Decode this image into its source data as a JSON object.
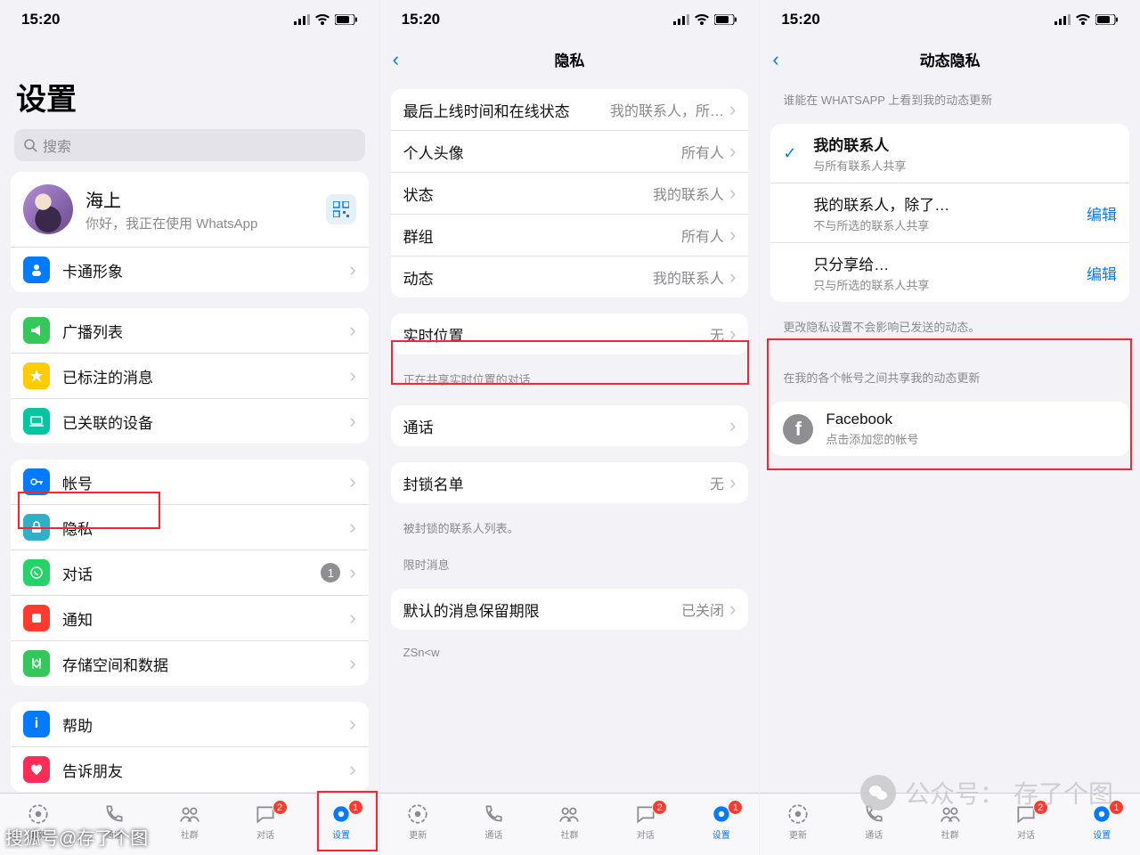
{
  "statusbar": {
    "time": "15:20"
  },
  "tabs": {
    "updates": "更新",
    "calls": "通话",
    "communities": "社群",
    "chats": "对话",
    "settings": "设置",
    "chats_badge": "2",
    "settings_badge": "1"
  },
  "screen1": {
    "title": "设置",
    "search_placeholder": "搜索",
    "profile": {
      "name": "海上",
      "status": "你好，我正在使用 WhatsApp"
    },
    "avatar_row": "卡通形象",
    "group_lists": {
      "broadcast": "广播列表",
      "starred": "已标注的消息",
      "linked": "已关联的设备"
    },
    "group_main": {
      "account": "帐号",
      "privacy": "隐私",
      "chats": "对话",
      "chats_badge": "1",
      "notifications": "通知",
      "storage": "存储空间和数据"
    },
    "group_help": {
      "help": "帮助",
      "tell": "告诉朋友"
    }
  },
  "screen2": {
    "nav_title": "隐私",
    "rows": {
      "lastseen": {
        "label": "最后上线时间和在线状态",
        "value": "我的联系人，所…"
      },
      "photo": {
        "label": "个人头像",
        "value": "所有人"
      },
      "about": {
        "label": "状态",
        "value": "我的联系人"
      },
      "groups": {
        "label": "群组",
        "value": "所有人"
      },
      "status": {
        "label": "动态",
        "value": "我的联系人"
      },
      "live": {
        "label": "实时位置",
        "value": "无"
      },
      "live_footer": "正在共享实时位置的对话",
      "calls": {
        "label": "通话"
      },
      "blocked": {
        "label": "封锁名单",
        "value": "无"
      },
      "blocked_footer": "被封锁的联系人列表。",
      "disappearing_header": "限时消息",
      "default_timer": {
        "label": "默认的消息保留期限",
        "value": "已关闭"
      },
      "zsn": "ZSn<w"
    }
  },
  "screen3": {
    "nav_title": "动态隐私",
    "section1_header": "谁能在 WHATSAPP 上看到我的动态更新",
    "opt1": {
      "label": "我的联系人",
      "sub": "与所有联系人共享"
    },
    "opt2": {
      "label": "我的联系人，除了…",
      "sub": "不与所选的联系人共享",
      "action": "编辑"
    },
    "opt3": {
      "label": "只分享给…",
      "sub": "只与所选的联系人共享",
      "action": "编辑"
    },
    "section1_footer": "更改隐私设置不会影响已发送的动态。",
    "section2_header": "在我的各个帐号之间共享我的动态更新",
    "fb": {
      "label": "Facebook",
      "sub": "点击添加您的帐号"
    }
  },
  "watermarks": {
    "left": "搜狐号@存了个图",
    "right_prefix": "公众号：",
    "right_name": "存了个图"
  }
}
